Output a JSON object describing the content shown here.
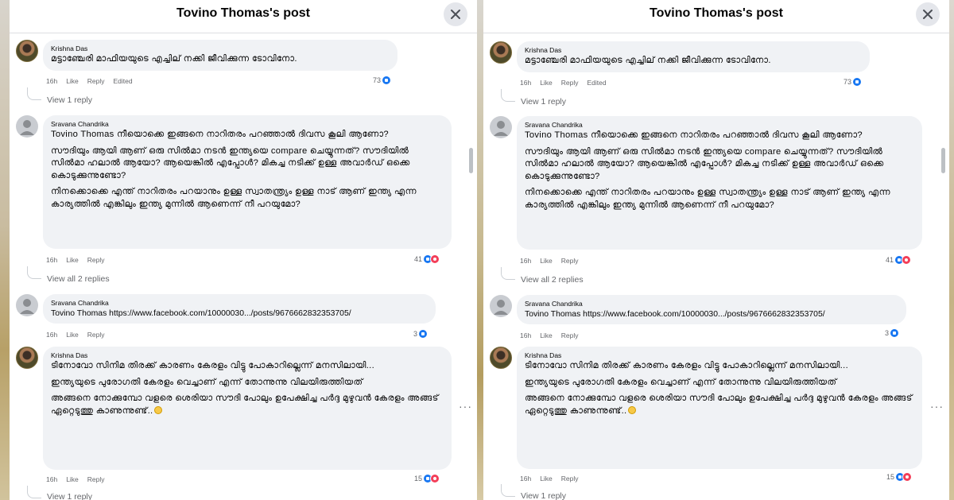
{
  "header": {
    "title": "Tovino Thomas's post"
  },
  "comments": [
    {
      "author": "Krishna Das",
      "paragraphs": [
        "മട്ടാഞ്ചേരി മാഫിയയുടെ എച്ചില് നക്കി ജീവിക്കുന്ന ടോവിനോ."
      ],
      "actions": {
        "age": "16h",
        "like": "Like",
        "reply": "Reply",
        "edited": "Edited"
      },
      "reaction_count": "73",
      "replies_link": "View 1 reply"
    },
    {
      "author": "Sravana Chandrika",
      "mention": "Tovino Thomas",
      "paragraphs": [
        "നീയൊക്കെ ഇങ്ങനെ നാറിതരം പറഞ്ഞാൽ ദിവസ കൂലി ആണോ?",
        "സൗദിയും ആയി ആണ് ഒരു സിൽമാ നടൻ ഇന്ത്യയെ compare ചെയ്യുന്നത്? സൗദിയിൽ സിൽമാ ഹലാൽ ആയോ? ആയെങ്കിൽ എപ്പോൾ? മികച്ച നടിക്ക് ഉള്ള അവാർഡ് ഒക്കെ കൊടുക്കുന്നുണ്ടോ?",
        "നിനക്കൊക്കെ എന്ത് നാറിതരം പറയാനും ഉള്ള സ്വാതന്ത്ര്യം ഉള്ള നാട് ആണ് ഇന്ത്യ എന്ന കാര്യത്തിൽ എങ്കിലും ഇന്ത്യ മുന്നിൽ ആണെന്ന് നീ പറയുമോ?"
      ],
      "actions": {
        "age": "16h",
        "like": "Like",
        "reply": "Reply"
      },
      "reaction_count": "41",
      "replies_link": "View all 2 replies"
    },
    {
      "author": "Sravana Chandrika",
      "mention": "Tovino Thomas",
      "link": "https://www.facebook.com/10000030.../posts/9676662832353705/",
      "actions": {
        "age": "16h",
        "like": "Like",
        "reply": "Reply"
      },
      "reaction_count": "3"
    },
    {
      "author": "Krishna Das",
      "paragraphs": [
        "ടിനോവോ സിനിമ തിരക്ക് കാരണം കേരളം വിട്ടു പോകാറില്ലെന്ന് മനസിലായി...",
        "ഇന്ത്യയുടെ പുരോഗതി കേരളം വെച്ചാണ് എന്ന് തോന്നുന്നു വിലയിരുത്തിയത്",
        "അങ്ങനെ നോക്കുമ്പോ വളരെ ശെരിയാ സൗദി പോലും ഉപേക്ഷിച്ച പർദ്ദ മുഴുവൻ കേരളം അങ്ങട് ഏറ്റെടുത്തു കാണുന്നുണ്ട്.."
      ],
      "actions": {
        "age": "16h",
        "like": "Like",
        "reply": "Reply"
      },
      "reaction_count": "15",
      "replies_link": "View 1 reply"
    }
  ],
  "icons": {
    "close": "close-icon",
    "more": "more-options-icon",
    "like": "like-reaction-icon",
    "love": "love-reaction-icon",
    "emoji": "grinning-emoji-icon"
  },
  "colors": {
    "bubble": "#f0f2f5",
    "like_blue": "#1877f2",
    "love_red": "#f33e58",
    "meta_gray": "#65676b"
  }
}
